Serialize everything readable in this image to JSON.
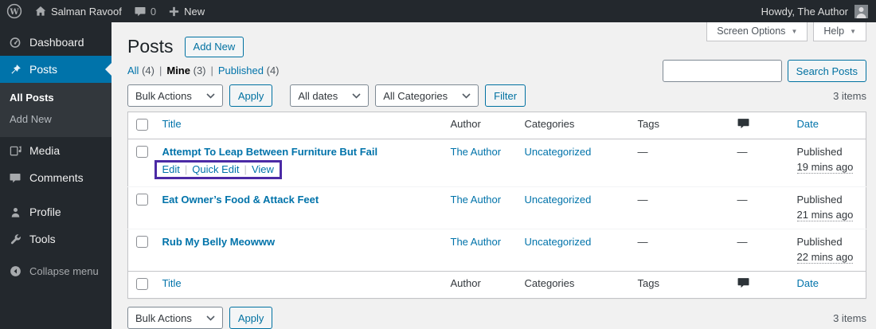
{
  "admin_bar": {
    "site_name": "Salman Ravoof",
    "comments_count": "0",
    "new_label": "New",
    "howdy": "Howdy, The Author"
  },
  "sidebar": {
    "dashboard": "Dashboard",
    "posts": "Posts",
    "all_posts": "All Posts",
    "add_new": "Add New",
    "media": "Media",
    "comments": "Comments",
    "profile": "Profile",
    "tools": "Tools",
    "collapse": "Collapse menu"
  },
  "page": {
    "title": "Posts",
    "add_new_button": "Add New",
    "screen_options": "Screen Options",
    "help": "Help"
  },
  "views": {
    "all": "All",
    "all_count": "(4)",
    "mine": "Mine",
    "mine_count": "(3)",
    "published": "Published",
    "published_count": "(4)",
    "separator": "|"
  },
  "search": {
    "value": "",
    "button": "Search Posts"
  },
  "toolbar": {
    "bulk_actions": "Bulk Actions",
    "apply": "Apply",
    "all_dates": "All dates",
    "all_categories": "All Categories",
    "filter": "Filter",
    "items_count": "3 items"
  },
  "table": {
    "columns": {
      "title": "Title",
      "author": "Author",
      "categories": "Categories",
      "tags": "Tags",
      "date": "Date"
    },
    "row_actions": {
      "edit": "Edit",
      "quick_edit": "Quick Edit",
      "view": "View",
      "separator": "|"
    },
    "rows": [
      {
        "title": "Attempt To Leap Between Furniture But Fail",
        "author": "The Author",
        "category": "Uncategorized",
        "tags": "—",
        "comments": "—",
        "status": "Published",
        "date": "19 mins ago"
      },
      {
        "title": "Eat Owner’s Food & Attack Feet",
        "author": "The Author",
        "category": "Uncategorized",
        "tags": "—",
        "comments": "—",
        "status": "Published",
        "date": "21 mins ago"
      },
      {
        "title": "Rub My Belly Meowww",
        "author": "The Author",
        "category": "Uncategorized",
        "tags": "—",
        "comments": "—",
        "status": "Published",
        "date": "22 mins ago"
      }
    ]
  },
  "icons": {
    "caret_down": "▼"
  },
  "colors": {
    "accent_blue": "#0073aa",
    "admin_dark": "#23282d",
    "submenu_dark": "#32373c",
    "content_bg": "#f1f1f1",
    "highlight_purple": "#4b2aa5",
    "border_gray": "#c3c4c7"
  }
}
